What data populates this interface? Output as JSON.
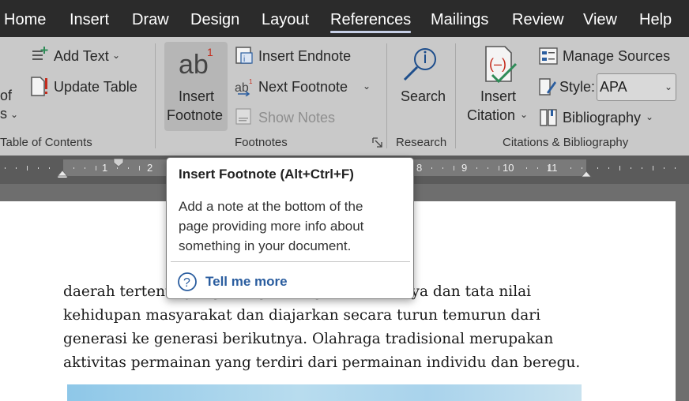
{
  "tabs": [
    {
      "label": "Home",
      "active": false
    },
    {
      "label": "Insert",
      "active": false
    },
    {
      "label": "Draw",
      "active": false
    },
    {
      "label": "Design",
      "active": false
    },
    {
      "label": "Layout",
      "active": false
    },
    {
      "label": "References",
      "active": true
    },
    {
      "label": "Mailings",
      "active": false
    },
    {
      "label": "Review",
      "active": false
    },
    {
      "label": "View",
      "active": false
    },
    {
      "label": "Help",
      "active": false
    }
  ],
  "ribbon": {
    "toc": {
      "partial_label_1": "of",
      "partial_label_2": "s",
      "add_text": "Add Text",
      "update_table": "Update Table",
      "group_label": "Table of Contents"
    },
    "footnotes": {
      "insert_footnote_line1": "Insert",
      "insert_footnote_line2": "Footnote",
      "insert_endnote": "Insert Endnote",
      "next_footnote": "Next Footnote",
      "show_notes": "Show Notes",
      "group_label": "Footnotes"
    },
    "research": {
      "search": "Search",
      "group_label": "Research"
    },
    "citations": {
      "insert_citation_line1": "Insert",
      "insert_citation_line2": "Citation",
      "manage_sources": "Manage Sources",
      "style_label": "Style:",
      "style_value": "APA",
      "bibliography": "Bibliography",
      "group_label": "Citations & Bibliography"
    }
  },
  "ruler": {
    "numbers": [
      "1",
      "2",
      "8",
      "9",
      "10",
      "11"
    ]
  },
  "tooltip": {
    "title": "Insert Footnote (Alt+Ctrl+F)",
    "body_lines": [
      "Add a note at the bottom of the",
      "page providing more info about",
      "something in your document."
    ],
    "link": "Tell me more"
  },
  "document": {
    "lines": [
      "daerah tertentu yang mengandung unsur budaya dan tata nilai",
      "kehidupan masyarakat dan diajarkan secara turun temurun dari",
      "generasi ke generasi berikutnya. Olahraga tradisional merupakan",
      "aktivitas permainan yang terdiri dari permainan individu dan beregu."
    ]
  },
  "colors": {
    "tab_bar": "#2b2b2b",
    "ribbon": "#c9c9c9",
    "link": "#2a5d9f",
    "endnote_icon": "#2a5d9f",
    "alert_red": "#c42b1c",
    "citation_check": "#2e8b57"
  }
}
